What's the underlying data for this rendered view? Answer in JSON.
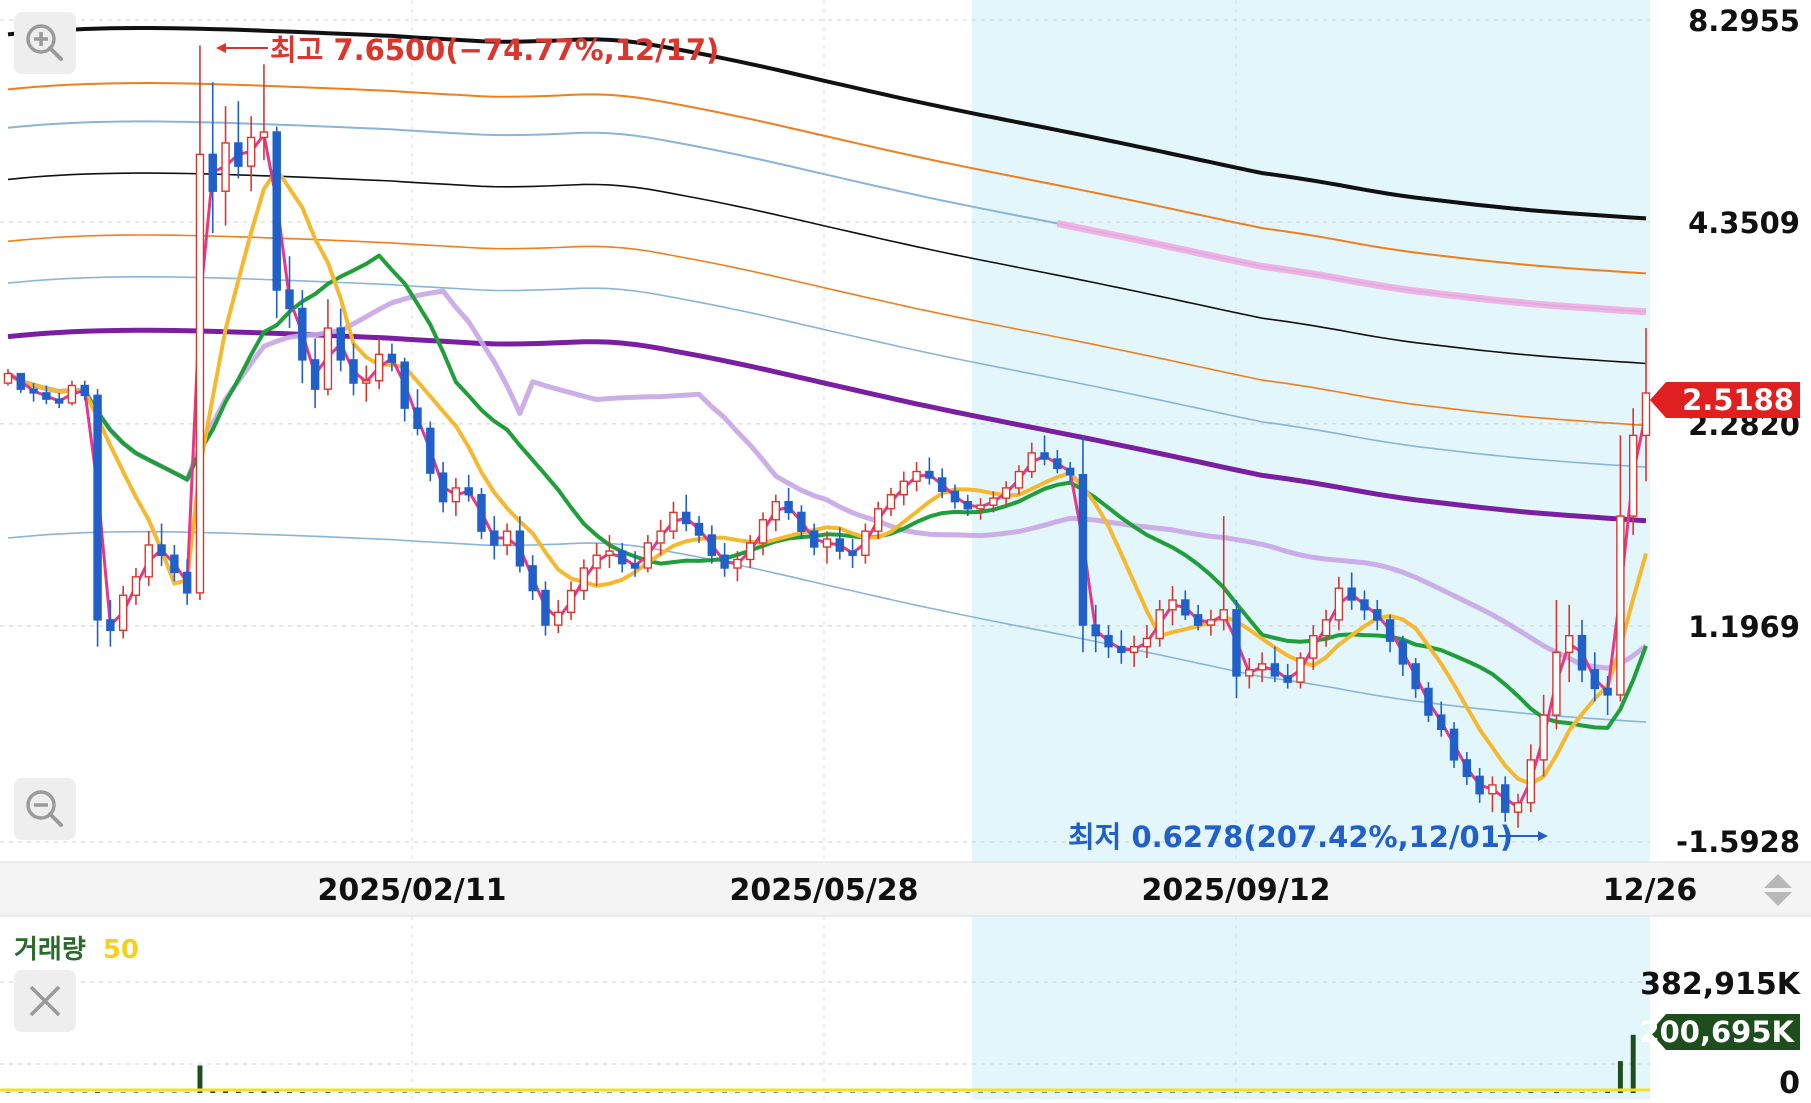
{
  "chart_data": {
    "type": "candlestick",
    "price_axis": {
      "scale": "log",
      "tick_labels": [
        "8.2955",
        "4.3509",
        "2.2820",
        "1.1969",
        "-1.5928"
      ],
      "tick_values": [
        8.2955,
        4.3509,
        2.282,
        1.1969,
        0.6
      ],
      "current_price_label": "2.5188",
      "current_price": 2.5188
    },
    "date_axis": {
      "labels": [
        "2025/02/11",
        "2025/05/28",
        "2025/09/12",
        "12/26"
      ]
    },
    "annotations": {
      "high": {
        "text": "최고 7.6500(−74.77%,12/17)",
        "value": 7.65
      },
      "low": {
        "text": "최저 0.6278(207.42%,12/01)",
        "value": 0.6278
      }
    },
    "volume": {
      "title": "거래량",
      "ma_label": "50",
      "tick_labels": [
        "382,915K",
        "0"
      ],
      "current_label": "200,695K",
      "current_value": 200695,
      "max_label_value": 382915
    },
    "series": {
      "candles": [
        [
          2.6,
          2.72,
          2.58,
          2.68
        ],
        [
          2.68,
          2.66,
          2.52,
          2.55
        ],
        [
          2.55,
          2.6,
          2.45,
          2.52
        ],
        [
          2.52,
          2.58,
          2.43,
          2.47
        ],
        [
          2.47,
          2.52,
          2.4,
          2.44
        ],
        [
          2.44,
          2.62,
          2.42,
          2.58
        ],
        [
          2.58,
          2.62,
          2.46,
          2.5
        ],
        [
          2.5,
          2.55,
          1.12,
          1.22
        ],
        [
          1.22,
          1.3,
          1.12,
          1.18
        ],
        [
          1.18,
          1.36,
          1.15,
          1.32
        ],
        [
          1.32,
          1.44,
          1.28,
          1.4
        ],
        [
          1.4,
          1.62,
          1.36,
          1.55
        ],
        [
          1.55,
          1.66,
          1.45,
          1.5
        ],
        [
          1.5,
          1.55,
          1.38,
          1.42
        ],
        [
          1.42,
          1.48,
          1.28,
          1.33
        ],
        [
          1.33,
          7.65,
          1.3,
          5.4
        ],
        [
          5.4,
          6.8,
          4.2,
          4.8
        ],
        [
          4.8,
          6.3,
          4.3,
          5.6
        ],
        [
          5.6,
          6.4,
          5.0,
          5.2
        ],
        [
          5.2,
          6.1,
          4.8,
          5.7
        ],
        [
          5.7,
          7.2,
          5.3,
          5.8
        ],
        [
          5.8,
          5.9,
          3.2,
          3.5
        ],
        [
          3.5,
          3.9,
          3.1,
          3.3
        ],
        [
          3.3,
          3.5,
          2.6,
          2.8
        ],
        [
          2.8,
          3.0,
          2.4,
          2.55
        ],
        [
          2.55,
          3.4,
          2.5,
          3.1
        ],
        [
          3.1,
          3.3,
          2.7,
          2.8
        ],
        [
          2.8,
          2.95,
          2.5,
          2.6
        ],
        [
          2.6,
          2.75,
          2.45,
          2.62
        ],
        [
          2.62,
          3.0,
          2.55,
          2.85
        ],
        [
          2.85,
          2.95,
          2.7,
          2.78
        ],
        [
          2.78,
          2.82,
          2.3,
          2.4
        ],
        [
          2.4,
          2.55,
          2.2,
          2.25
        ],
        [
          2.25,
          2.3,
          1.9,
          1.95
        ],
        [
          1.95,
          2.02,
          1.72,
          1.78
        ],
        [
          1.78,
          1.92,
          1.7,
          1.86
        ],
        [
          1.86,
          1.94,
          1.78,
          1.82
        ],
        [
          1.82,
          1.86,
          1.58,
          1.62
        ],
        [
          1.62,
          1.7,
          1.48,
          1.55
        ],
        [
          1.55,
          1.66,
          1.5,
          1.62
        ],
        [
          1.62,
          1.7,
          1.42,
          1.45
        ],
        [
          1.45,
          1.5,
          1.3,
          1.34
        ],
        [
          1.34,
          1.38,
          1.16,
          1.2
        ],
        [
          1.2,
          1.3,
          1.17,
          1.25
        ],
        [
          1.25,
          1.38,
          1.22,
          1.34
        ],
        [
          1.34,
          1.48,
          1.3,
          1.44
        ],
        [
          1.44,
          1.56,
          1.36,
          1.5
        ],
        [
          1.5,
          1.6,
          1.44,
          1.52
        ],
        [
          1.52,
          1.56,
          1.42,
          1.46
        ],
        [
          1.46,
          1.52,
          1.4,
          1.44
        ],
        [
          1.44,
          1.6,
          1.42,
          1.56
        ],
        [
          1.56,
          1.68,
          1.5,
          1.62
        ],
        [
          1.62,
          1.78,
          1.58,
          1.72
        ],
        [
          1.72,
          1.82,
          1.62,
          1.66
        ],
        [
          1.66,
          1.7,
          1.56,
          1.6
        ],
        [
          1.6,
          1.65,
          1.46,
          1.5
        ],
        [
          1.5,
          1.56,
          1.4,
          1.44
        ],
        [
          1.44,
          1.52,
          1.38,
          1.48
        ],
        [
          1.48,
          1.6,
          1.44,
          1.56
        ],
        [
          1.56,
          1.72,
          1.5,
          1.68
        ],
        [
          1.68,
          1.82,
          1.62,
          1.78
        ],
        [
          1.78,
          1.86,
          1.68,
          1.72
        ],
        [
          1.72,
          1.76,
          1.58,
          1.62
        ],
        [
          1.62,
          1.66,
          1.5,
          1.54
        ],
        [
          1.54,
          1.62,
          1.46,
          1.58
        ],
        [
          1.58,
          1.64,
          1.48,
          1.52
        ],
        [
          1.52,
          1.58,
          1.44,
          1.5
        ],
        [
          1.5,
          1.66,
          1.46,
          1.62
        ],
        [
          1.62,
          1.78,
          1.58,
          1.74
        ],
        [
          1.74,
          1.86,
          1.7,
          1.82
        ],
        [
          1.82,
          1.96,
          1.76,
          1.9
        ],
        [
          1.9,
          2.02,
          1.84,
          1.96
        ],
        [
          1.96,
          2.05,
          1.88,
          1.92
        ],
        [
          1.92,
          1.98,
          1.8,
          1.84
        ],
        [
          1.84,
          1.88,
          1.74,
          1.78
        ],
        [
          1.78,
          1.82,
          1.7,
          1.74
        ],
        [
          1.74,
          1.8,
          1.68,
          1.76
        ],
        [
          1.76,
          1.84,
          1.72,
          1.8
        ],
        [
          1.8,
          1.9,
          1.76,
          1.86
        ],
        [
          1.86,
          2.0,
          1.82,
          1.96
        ],
        [
          1.96,
          2.15,
          1.92,
          2.08
        ],
        [
          2.08,
          2.2,
          2.0,
          2.04
        ],
        [
          2.04,
          2.1,
          1.95,
          1.98
        ],
        [
          1.98,
          2.02,
          1.9,
          1.94
        ],
        [
          1.94,
          2.2,
          1.1,
          1.2
        ],
        [
          1.2,
          1.28,
          1.1,
          1.16
        ],
        [
          1.16,
          1.2,
          1.08,
          1.12
        ],
        [
          1.12,
          1.18,
          1.06,
          1.1
        ],
        [
          1.1,
          1.16,
          1.05,
          1.12
        ],
        [
          1.12,
          1.2,
          1.08,
          1.15
        ],
        [
          1.15,
          1.3,
          1.12,
          1.26
        ],
        [
          1.26,
          1.36,
          1.2,
          1.3
        ],
        [
          1.3,
          1.34,
          1.22,
          1.24
        ],
        [
          1.24,
          1.28,
          1.18,
          1.2
        ],
        [
          1.2,
          1.26,
          1.16,
          1.22
        ],
        [
          1.22,
          1.7,
          1.18,
          1.26
        ],
        [
          1.26,
          1.3,
          0.95,
          1.02
        ],
        [
          1.02,
          1.08,
          0.98,
          1.04
        ],
        [
          1.04,
          1.1,
          1.0,
          1.06
        ],
        [
          1.06,
          1.12,
          1.0,
          1.02
        ],
        [
          1.02,
          1.06,
          0.98,
          1.0
        ],
        [
          1.0,
          1.1,
          0.98,
          1.08
        ],
        [
          1.08,
          1.2,
          1.04,
          1.16
        ],
        [
          1.16,
          1.26,
          1.12,
          1.22
        ],
        [
          1.22,
          1.4,
          1.18,
          1.35
        ],
        [
          1.35,
          1.42,
          1.26,
          1.3
        ],
        [
          1.3,
          1.34,
          1.22,
          1.26
        ],
        [
          1.26,
          1.3,
          1.18,
          1.22
        ],
        [
          1.22,
          1.24,
          1.1,
          1.14
        ],
        [
          1.14,
          1.16,
          1.02,
          1.06
        ],
        [
          1.06,
          1.08,
          0.95,
          0.98
        ],
        [
          0.98,
          1.0,
          0.88,
          0.9
        ],
        [
          0.9,
          0.94,
          0.84,
          0.86
        ],
        [
          0.86,
          0.88,
          0.76,
          0.78
        ],
        [
          0.78,
          0.8,
          0.72,
          0.74
        ],
        [
          0.74,
          0.76,
          0.68,
          0.7
        ],
        [
          0.7,
          0.74,
          0.66,
          0.72
        ],
        [
          0.72,
          0.74,
          0.64,
          0.66
        ],
        [
          0.66,
          0.7,
          0.6278,
          0.68
        ],
        [
          0.68,
          0.82,
          0.66,
          0.78
        ],
        [
          0.78,
          0.96,
          0.74,
          0.9
        ],
        [
          0.9,
          1.3,
          0.86,
          1.1
        ],
        [
          1.1,
          1.28,
          1.0,
          1.16
        ],
        [
          1.16,
          1.22,
          1.0,
          1.04
        ],
        [
          1.04,
          1.1,
          0.94,
          0.98
        ],
        [
          0.98,
          1.02,
          0.9,
          0.96
        ],
        [
          0.96,
          2.2,
          0.94,
          1.7
        ],
        [
          1.7,
          2.4,
          1.6,
          2.2
        ],
        [
          2.2,
          3.1,
          1.9,
          2.5188
        ]
      ],
      "volume": [
        2,
        2,
        2,
        2,
        2,
        2,
        2,
        3,
        2,
        2,
        2,
        2,
        2,
        2,
        2,
        95,
        12,
        5,
        4,
        3,
        6,
        4,
        3,
        3,
        2,
        3,
        2,
        2,
        2,
        2,
        2,
        2,
        2,
        2,
        2,
        2,
        2,
        2,
        2,
        2,
        2,
        2,
        2,
        2,
        2,
        2,
        2,
        2,
        2,
        2,
        2,
        2,
        2,
        2,
        2,
        2,
        2,
        2,
        2,
        2,
        2,
        2,
        2,
        2,
        2,
        2,
        2,
        2,
        2,
        2,
        2,
        2,
        2,
        2,
        2,
        2,
        2,
        2,
        2,
        2,
        2,
        2,
        2,
        3,
        2,
        2,
        2,
        2,
        2,
        2,
        2,
        2,
        2,
        2,
        2,
        2,
        2,
        2,
        2,
        2,
        2,
        2,
        2,
        2,
        2,
        2,
        2,
        2,
        2,
        2,
        2,
        2,
        2,
        2,
        2,
        2,
        2,
        2,
        2,
        3,
        2,
        3,
        2,
        2,
        2,
        4,
        110,
        200.695
      ]
    },
    "legend_colors": {
      "up": "#d9362e",
      "down": "#2060c8",
      "ma_fast": "#e8368a",
      "ma_yellow": "#f5b82e",
      "ma_green": "#1f9e3a",
      "ma_purple": "#7a1fa2",
      "ma_lavender": "#c7a6e6",
      "ma_pink": "#f0a8e0",
      "band_black": "#111111",
      "band_orange": "#f07e1e",
      "band_blue": "#8ab4d8",
      "highlight_bg": "#e3f6fc",
      "volume_bar": "#1e4d1e",
      "price_tag": "#e02020",
      "volume_tag": "#1e4d1e"
    }
  }
}
